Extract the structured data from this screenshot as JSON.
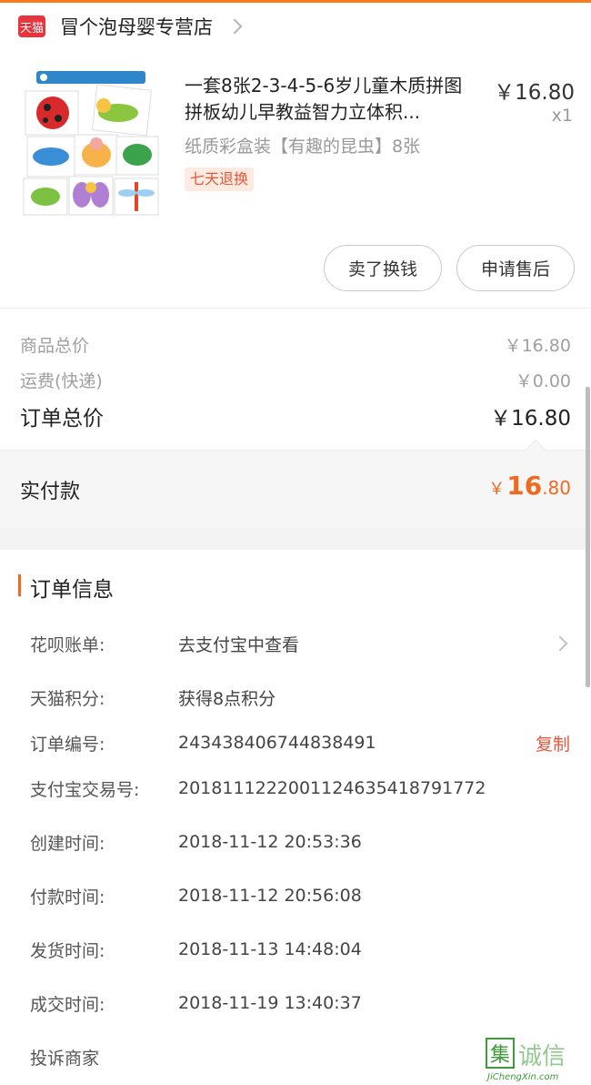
{
  "store": {
    "logo_text": "天猫",
    "name": "冒个泡母婴专营店"
  },
  "product": {
    "image_caption": "有趣的昆虫 (8张)",
    "title": "一套8张2-3-4-5-6岁儿童木质拼图拼板幼儿早教益智力立体积...",
    "price": "￥16.80",
    "quantity": "x1",
    "sku": "纸质彩盒装【有趣的昆虫】8张",
    "tag": "七天退换"
  },
  "actions": {
    "sell_label": "卖了换钱",
    "after_sale_label": "申请售后"
  },
  "fees": {
    "goods_label": "商品总价",
    "goods_value": "￥16.80",
    "shipping_label": "运费(快递)",
    "shipping_value": "￥0.00",
    "order_total_label": "订单总价",
    "order_total_value": "￥16.80"
  },
  "payment": {
    "label": "实付款",
    "currency": "￥",
    "integer": "16",
    "decimal": ".80"
  },
  "order_info": {
    "title": "订单信息",
    "rows": [
      {
        "key": "花呗账单:",
        "value": "去支付宝中查看"
      },
      {
        "key": "天猫积分:",
        "value": "获得8点积分"
      },
      {
        "key": "订单编号:",
        "value": "243438406744838491",
        "action": "复制"
      },
      {
        "key": "支付宝交易号:",
        "value": "2018111222001124635418791772"
      },
      {
        "key": "创建时间:",
        "value": "2018-11-12 20:53:36"
      },
      {
        "key": "付款时间:",
        "value": "2018-11-12 20:56:08"
      },
      {
        "key": "发货时间:",
        "value": "2018-11-13 14:48:04"
      },
      {
        "key": "成交时间:",
        "value": "2018-11-19 13:40:37"
      }
    ],
    "complain_label": "投诉商家"
  },
  "watermark": {
    "box_text": "集",
    "word": "诚信",
    "url": "JiChengXin.com"
  },
  "colors": {
    "accent": "#ef6a1f",
    "tmall_red": "#e8343d",
    "tag_red": "#e4573a"
  }
}
